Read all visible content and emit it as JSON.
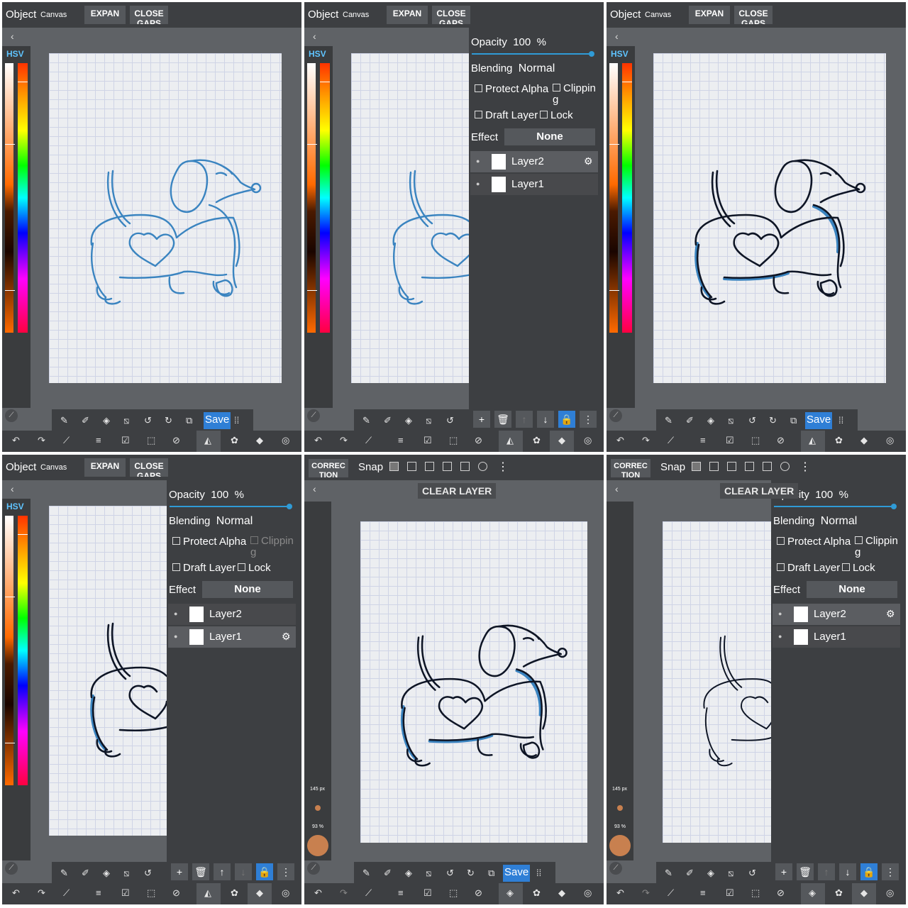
{
  "topbar": {
    "object": "Object",
    "canvas": "Canvas",
    "expand": "EXPAN",
    "close_gaps": "CLOSE GAPS",
    "correction": "CORREC TION",
    "snap": "Snap",
    "more": "⋮"
  },
  "hsv_label": "HSV",
  "tools": {
    "save": "Save",
    "clear_layer": "CLEAR LAYER"
  },
  "layer_panel": {
    "opacity_label": "Opacity",
    "opacity_value": "100",
    "opacity_unit": "%",
    "blending_label": "Blending",
    "blending_value": "Normal",
    "protect_alpha": "Protect Alpha",
    "clipping": "Clippin g",
    "draft_layer": "Draft Layer",
    "lock": "Lock",
    "effect_label": "Effect",
    "effect_value": "None"
  },
  "layers": {
    "layer2": "Layer2",
    "layer1": "Layer1"
  },
  "brush": {
    "size": "145 px",
    "opacity": "93 %"
  },
  "colors": {
    "accent": "#2f7fd6",
    "blue_line": "#3a84c0",
    "black_line": "#0e1525",
    "brush": "#c8804f"
  }
}
